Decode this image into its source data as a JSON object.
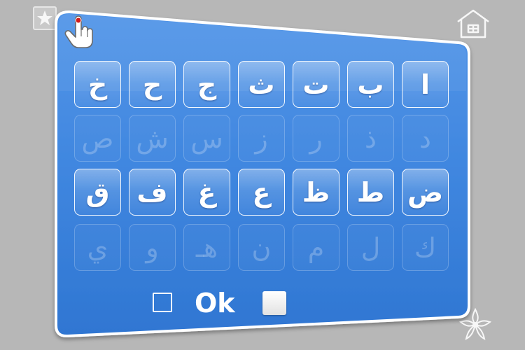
{
  "keys": [
    [
      "خ",
      "ح",
      "ج",
      "ث",
      "ت",
      "ب",
      "ا"
    ],
    [
      "ص",
      "ش",
      "س",
      "ز",
      "ر",
      "ذ",
      "د"
    ],
    [
      "ق",
      "ف",
      "غ",
      "ع",
      "ظ",
      "ط",
      "ض"
    ],
    [
      "ي",
      "و",
      "هـ",
      "ن",
      "م",
      "ل",
      "ك"
    ]
  ],
  "key_states": [
    [
      "active",
      "active",
      "active",
      "active",
      "active",
      "active",
      "active"
    ],
    [
      "inactive",
      "inactive",
      "inactive",
      "inactive",
      "inactive",
      "inactive",
      "inactive"
    ],
    [
      "active",
      "active",
      "active",
      "active",
      "active",
      "active",
      "active"
    ],
    [
      "inactive",
      "inactive",
      "inactive",
      "inactive",
      "inactive",
      "inactive",
      "inactive"
    ]
  ],
  "ok_label": "Ok",
  "left_checkbox_checked": false,
  "right_checkbox_checked": true,
  "icons": {
    "top_left": "star-icon",
    "cursor": "hand-pointer-icon",
    "top_right": "house-icon",
    "bottom_right": "flower-icon"
  },
  "colors": {
    "background": "#b7b7b7",
    "panel_blue": "#3f86df",
    "panel_border": "#ffffff",
    "letter_active": "#ffffff"
  }
}
